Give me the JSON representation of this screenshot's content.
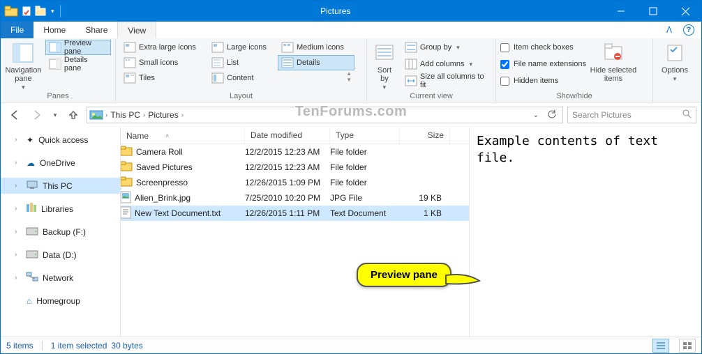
{
  "window": {
    "title": "Pictures"
  },
  "tabs": {
    "file": "File",
    "home": "Home",
    "share": "Share",
    "view": "View"
  },
  "ribbon": {
    "panes": {
      "label": "Panes",
      "nav": "Navigation\npane",
      "preview": "Preview pane",
      "details": "Details pane"
    },
    "layout": {
      "label": "Layout",
      "xl": "Extra large icons",
      "large": "Large icons",
      "medium": "Medium icons",
      "small": "Small icons",
      "list": "List",
      "details": "Details",
      "tiles": "Tiles",
      "content": "Content"
    },
    "current": {
      "label": "Current view",
      "sort": "Sort\nby",
      "group": "Group by",
      "addcols": "Add columns",
      "sizecols": "Size all columns to fit"
    },
    "showhide": {
      "label": "Show/hide",
      "checkboxes": "Item check boxes",
      "ext": "File name extensions",
      "hidden": "Hidden items",
      "hidesel": "Hide selected\nitems"
    },
    "options": "Options"
  },
  "breadcrumb": {
    "root": "This PC",
    "folder": "Pictures"
  },
  "search": {
    "placeholder": "Search Pictures"
  },
  "nav": {
    "quick": "Quick access",
    "onedrive": "OneDrive",
    "thispc": "This PC",
    "libraries": "Libraries",
    "backup": "Backup (F:)",
    "data": "Data (D:)",
    "network": "Network",
    "homegroup": "Homegroup"
  },
  "columns": {
    "name": "Name",
    "date": "Date modified",
    "type": "Type",
    "size": "Size"
  },
  "files": [
    {
      "name": "Camera Roll",
      "date": "12/2/2015 12:23 AM",
      "type": "File folder",
      "size": "",
      "icon": "folder"
    },
    {
      "name": "Saved Pictures",
      "date": "12/2/2015 12:23 AM",
      "type": "File folder",
      "size": "",
      "icon": "folder"
    },
    {
      "name": "Screenpresso",
      "date": "12/26/2015 1:09 PM",
      "type": "File folder",
      "size": "",
      "icon": "folder"
    },
    {
      "name": "Alien_Brink.jpg",
      "date": "7/25/2010 10:20 PM",
      "type": "JPG File",
      "size": "19 KB",
      "icon": "jpg"
    },
    {
      "name": "New Text Document.txt",
      "date": "12/26/2015 1:11 PM",
      "type": "Text Document",
      "size": "1 KB",
      "icon": "txt",
      "selected": true
    }
  ],
  "preview": "Example contents of text file.",
  "status": {
    "items": "5 items",
    "selected": "1 item selected",
    "size": "30 bytes"
  },
  "callout": "Preview pane",
  "watermark": "TenForums.com"
}
